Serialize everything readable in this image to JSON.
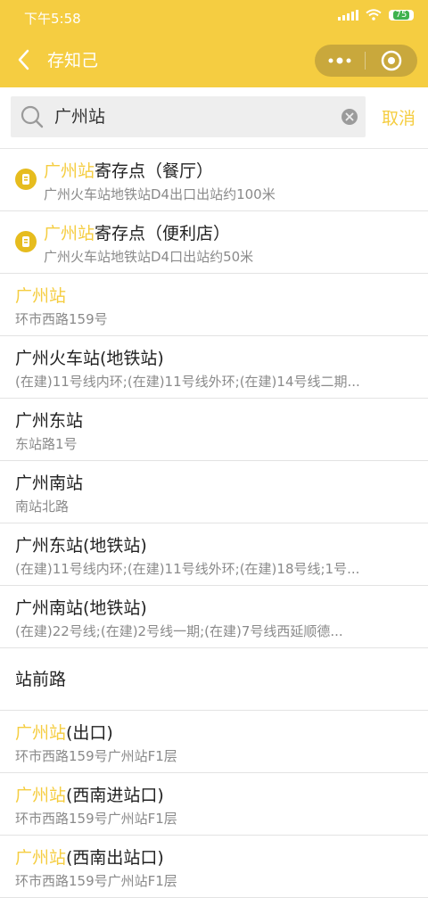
{
  "status_bar": {
    "time": "下午5:58",
    "battery": "75"
  },
  "nav": {
    "title": "存知己",
    "colors": {
      "brand": "#f5cd41",
      "highlight": "#f5cd41"
    }
  },
  "search": {
    "value": "广州站",
    "cancel_label": "取消"
  },
  "results": [
    {
      "highlight": "广州站",
      "rest": "寄存点（餐厅）",
      "sub": "广州火车站地铁站D4出口出站约100米",
      "pin": true
    },
    {
      "highlight": "广州站",
      "rest": "寄存点（便利店）",
      "sub": "广州火车站地铁站D4口出站约50米",
      "pin": true
    },
    {
      "highlight": "广州站",
      "rest": "",
      "sub": "环市西路159号",
      "pin": false
    },
    {
      "highlight": "",
      "rest": "广州火车站(地铁站)",
      "sub": "(在建)11号线内环;(在建)11号线外环;(在建)14号线二期...",
      "pin": false
    },
    {
      "highlight": "",
      "rest": "广州东站",
      "sub": "东站路1号",
      "pin": false
    },
    {
      "highlight": "",
      "rest": "广州南站",
      "sub": "南站北路",
      "pin": false
    },
    {
      "highlight": "",
      "rest": "广州东站(地铁站)",
      "sub": "(在建)11号线内环;(在建)11号线外环;(在建)18号线;1号...",
      "pin": false
    },
    {
      "highlight": "",
      "rest": "广州南站(地铁站)",
      "sub": "(在建)22号线;(在建)2号线一期;(在建)7号线西延顺德...",
      "pin": false
    },
    {
      "highlight": "",
      "rest": "站前路",
      "sub": "",
      "pin": false
    },
    {
      "highlight": "广州站",
      "rest": "(出口)",
      "sub": "环市西路159号广州站F1层",
      "pin": false
    },
    {
      "highlight": "广州站",
      "rest": "(西南进站口)",
      "sub": "环市西路159号广州站F1层",
      "pin": false
    },
    {
      "highlight": "广州站",
      "rest": "(西南出站口)",
      "sub": "环市西路159号广州站F1层",
      "pin": false
    }
  ]
}
